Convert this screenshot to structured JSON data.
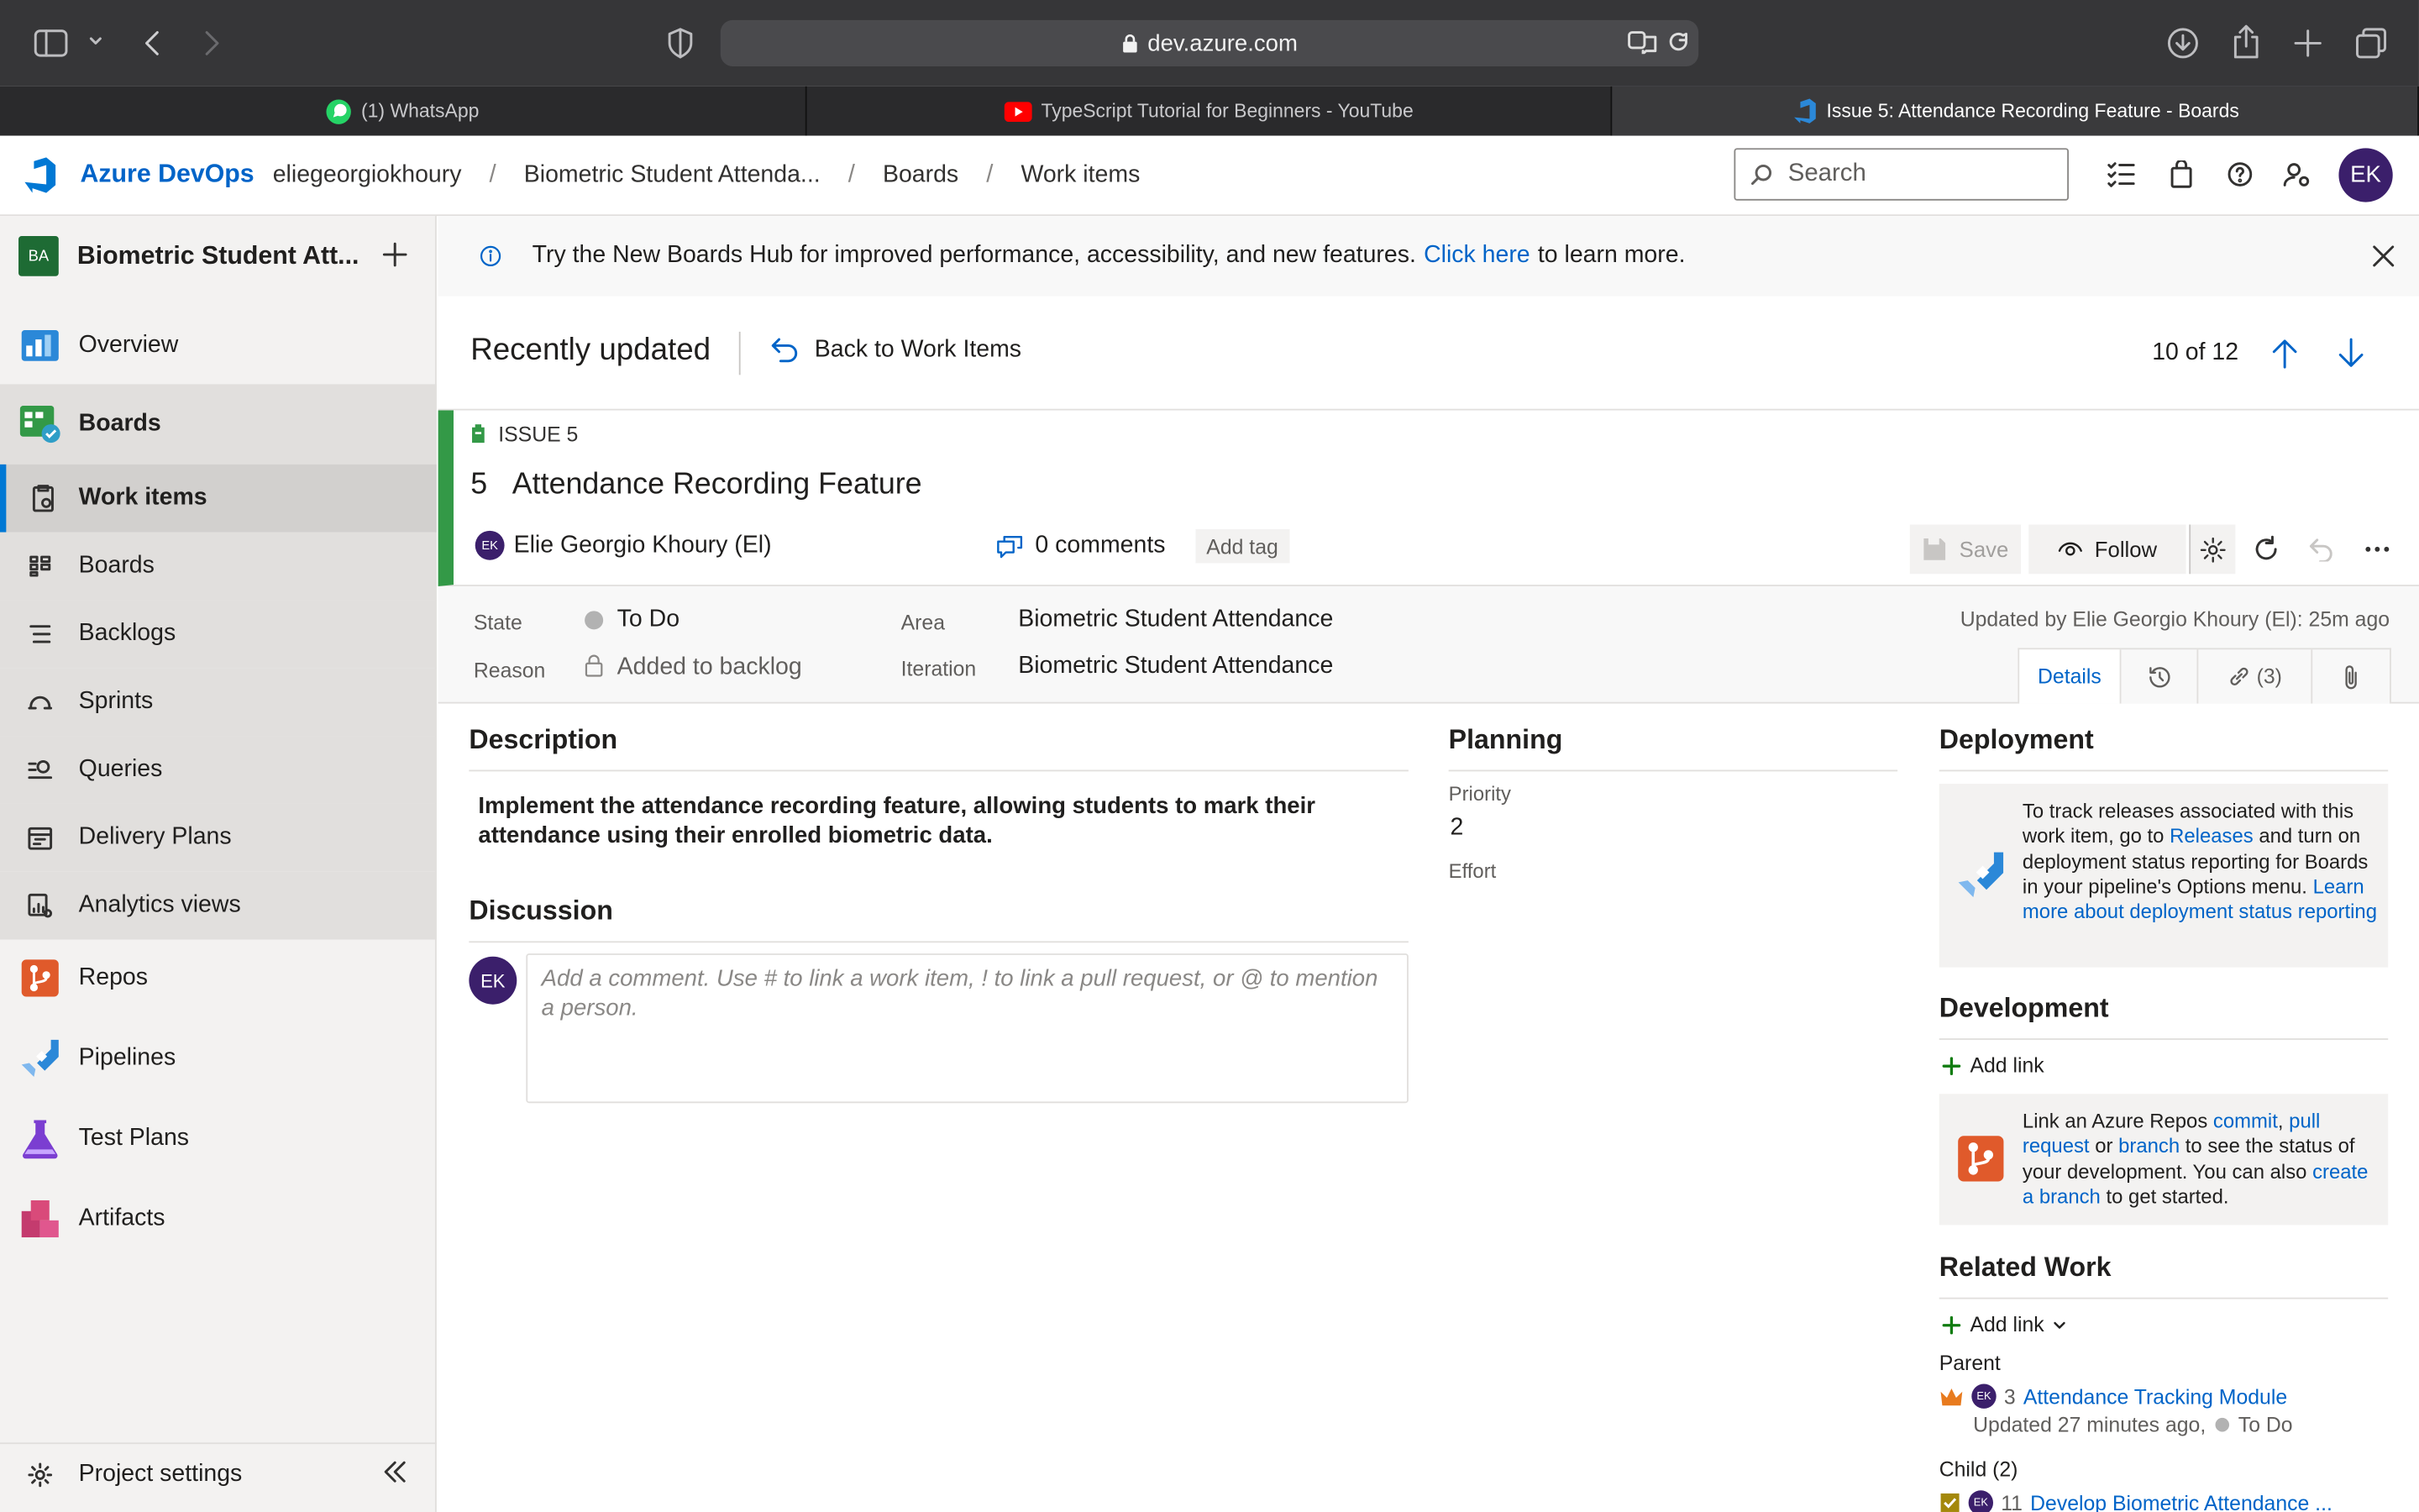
{
  "browser": {
    "url": "dev.azure.com",
    "tabs": [
      {
        "label": "(1) WhatsApp"
      },
      {
        "label": "TypeScript Tutorial for Beginners - YouTube"
      },
      {
        "label": "Issue 5: Attendance Recording Feature - Boards"
      }
    ]
  },
  "header": {
    "brand": "Azure DevOps",
    "breadcrumbs": [
      "eliegeorgiokhoury",
      "Biometric Student Attenda...",
      "Boards",
      "Work items"
    ],
    "search_placeholder": "Search",
    "avatar_initials": "EK"
  },
  "sidebar": {
    "project_badge": "BA",
    "project_name": "Biometric Student Att...",
    "items": [
      {
        "label": "Overview",
        "icon": "overview-icon"
      },
      {
        "label": "Boards",
        "icon": "boards-icon"
      },
      {
        "label": "Work items",
        "icon": "work-items-icon"
      },
      {
        "label": "Boards",
        "icon": "kanban-icon"
      },
      {
        "label": "Backlogs",
        "icon": "backlogs-icon"
      },
      {
        "label": "Sprints",
        "icon": "sprints-icon"
      },
      {
        "label": "Queries",
        "icon": "queries-icon"
      },
      {
        "label": "Delivery Plans",
        "icon": "delivery-plans-icon"
      },
      {
        "label": "Analytics views",
        "icon": "analytics-icon"
      },
      {
        "label": "Repos",
        "icon": "repos-icon"
      },
      {
        "label": "Pipelines",
        "icon": "pipelines-icon"
      },
      {
        "label": "Test Plans",
        "icon": "test-plans-icon"
      },
      {
        "label": "Artifacts",
        "icon": "artifacts-icon"
      }
    ],
    "settings_label": "Project settings"
  },
  "banner": {
    "text_before": "Try the New Boards Hub for improved performance, accessibility, and new features.",
    "link": "Click here",
    "text_after": "to learn more."
  },
  "toolbar": {
    "view_title": "Recently updated",
    "back_label": "Back to Work Items",
    "position": "10 of 12"
  },
  "work_item": {
    "type": "ISSUE 5",
    "id": "5",
    "title": "Attendance Recording Feature",
    "assignee_initials": "EK",
    "assignee": "Elie Georgio Khoury (El)",
    "comments": "0 comments",
    "add_tag": "Add tag",
    "save_label": "Save",
    "follow_label": "Follow"
  },
  "fields": {
    "state_label": "State",
    "state_value": "To Do",
    "reason_label": "Reason",
    "reason_value": "Added to backlog",
    "area_label": "Area",
    "area_value": "Biometric Student Attendance",
    "iteration_label": "Iteration",
    "iteration_value": "Biometric Student Attendance",
    "updated_by": "Updated by Elie Georgio Khoury (El): 25m ago",
    "tabs": {
      "details": "Details",
      "links": "(3)"
    }
  },
  "description": {
    "heading": "Description",
    "text": "Implement the attendance recording feature, allowing students to mark their attendance using their enrolled biometric data."
  },
  "discussion": {
    "heading": "Discussion",
    "avatar": "EK",
    "placeholder": "Add a comment. Use # to link a work item, ! to link a pull request, or @ to mention a person."
  },
  "planning": {
    "heading": "Planning",
    "priority_label": "Priority",
    "priority_value": "2",
    "effort_label": "Effort"
  },
  "deployment": {
    "heading": "Deployment",
    "t1": "To track releases associated with this work item, go to",
    "releases_link": "Releases",
    "t2": "and turn on deployment status reporting for Boards in your pipeline's Options menu.",
    "learn_link": "Learn more about deployment status reporting"
  },
  "development": {
    "heading": "Development",
    "add_link": "Add link",
    "t1": "Link an Azure Repos",
    "commit": "commit",
    "comma": ",",
    "pull_request": "pull request",
    "or": "or",
    "branch": "branch",
    "t2": "to see the status of your development. You can also",
    "create_branch": "create a branch",
    "t3": "to get started."
  },
  "related": {
    "heading": "Related Work",
    "add_link": "Add link",
    "parent_label": "Parent",
    "parent_id": "3",
    "parent_title": "Attendance Tracking Module",
    "parent_meta": "Updated 27 minutes ago,",
    "parent_state": "To Do",
    "child_label": "Child (2)",
    "child_id": "11",
    "child_title": "Develop Biometric Attendance ..."
  },
  "colors": {
    "accent": "#0064c8",
    "issue_green": "#339947",
    "avatar_purple": "#3b1f6b"
  }
}
